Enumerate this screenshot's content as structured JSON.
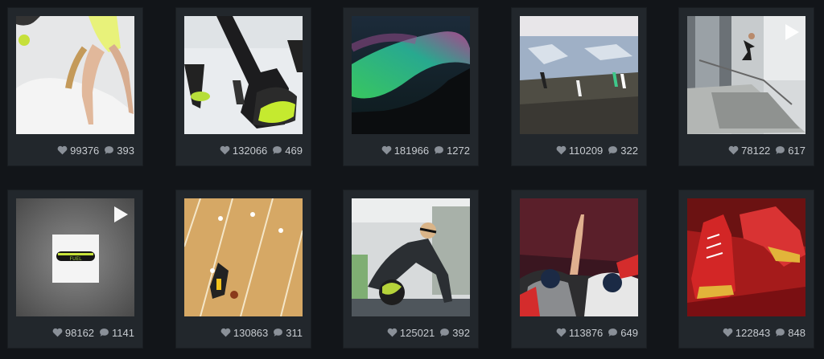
{
  "posts": [
    {
      "likes": "99376",
      "comments": "393",
      "video": false
    },
    {
      "likes": "132066",
      "comments": "469",
      "video": false
    },
    {
      "likes": "181966",
      "comments": "1272",
      "video": false
    },
    {
      "likes": "110209",
      "comments": "322",
      "video": false
    },
    {
      "likes": "78122",
      "comments": "617",
      "video": true
    },
    {
      "likes": "98162",
      "comments": "1141",
      "video": true
    },
    {
      "likes": "130863",
      "comments": "311",
      "video": false
    },
    {
      "likes": "125021",
      "comments": "392",
      "video": false
    },
    {
      "likes": "113876",
      "comments": "649",
      "video": false
    },
    {
      "likes": "122843",
      "comments": "848",
      "video": false
    }
  ],
  "icons": {
    "like": "heart-icon",
    "comment": "speech-bubble-icon",
    "video": "play-icon"
  },
  "colors": {
    "background": "#121519",
    "card": "#22272c",
    "stat_text": "#c7cbd0",
    "icon": "#8a9098"
  }
}
